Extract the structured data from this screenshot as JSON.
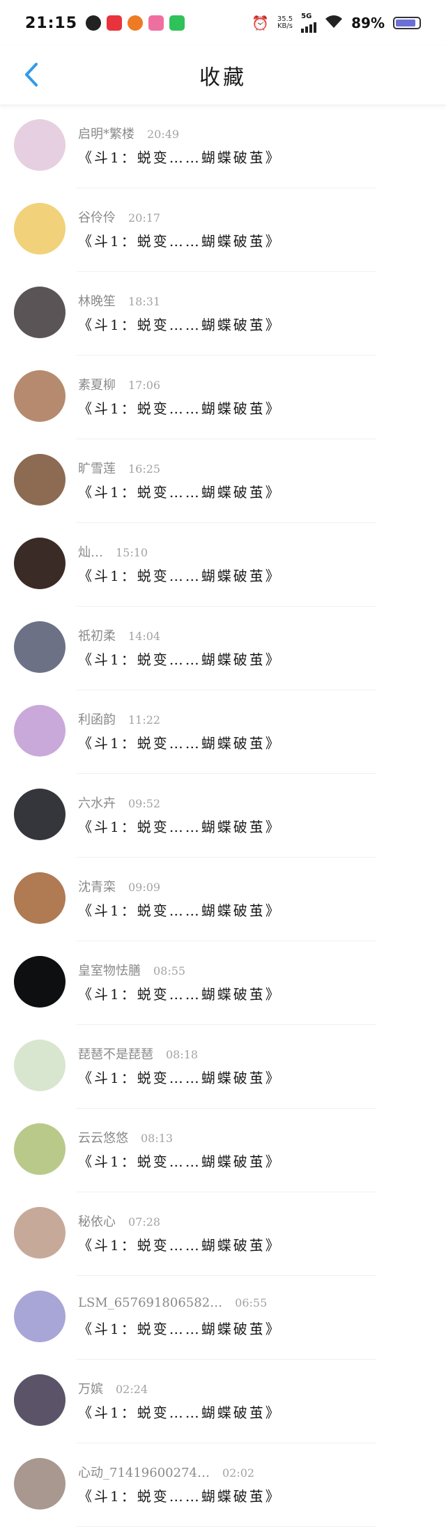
{
  "status_bar": {
    "time": "21:15",
    "network_speed": "35.5",
    "network_unit": "KB/s",
    "network_type": "5G",
    "battery": "89%",
    "battery_level": 0.89
  },
  "header": {
    "title": "收藏",
    "accent_color": "#2f9bea"
  },
  "favorites": [
    {
      "name": "启明*繁楼",
      "time": "20:49",
      "message": "《斗1：蜕变……蝴蝶破茧》",
      "avatar_color": "#e6cfe0"
    },
    {
      "name": "谷伶伶",
      "time": "20:17",
      "message": "《斗1：蜕变……蝴蝶破茧》",
      "avatar_color": "#f1d27a"
    },
    {
      "name": "林晚笙",
      "time": "18:31",
      "message": "《斗1：蜕变……蝴蝶破茧》",
      "avatar_color": "#5a5457"
    },
    {
      "name": "素夏柳",
      "time": "17:06",
      "message": "《斗1：蜕变……蝴蝶破茧》",
      "avatar_color": "#b58a6e"
    },
    {
      "name": "旷雪莲",
      "time": "16:25",
      "message": "《斗1：蜕变……蝴蝶破茧》",
      "avatar_color": "#8d6a52"
    },
    {
      "name": "灿…",
      "time": "15:10",
      "message": "《斗1：蜕变……蝴蝶破茧》",
      "avatar_color": "#3a2b27"
    },
    {
      "name": "祇初柔",
      "time": "14:04",
      "message": "《斗1：蜕变……蝴蝶破茧》",
      "avatar_color": "#6c7186"
    },
    {
      "name": "利函韵",
      "time": "11:22",
      "message": "《斗1：蜕变……蝴蝶破茧》",
      "avatar_color": "#c9a9d9"
    },
    {
      "name": "六水卉",
      "time": "09:52",
      "message": "《斗1：蜕变……蝴蝶破茧》",
      "avatar_color": "#34363c"
    },
    {
      "name": "沈青栾",
      "time": "09:09",
      "message": "《斗1：蜕变……蝴蝶破茧》",
      "avatar_color": "#b07a52"
    },
    {
      "name": "皇室物怯膳",
      "time": "08:55",
      "message": "《斗1：蜕变……蝴蝶破茧》",
      "avatar_color": "#0e0f11"
    },
    {
      "name": "琵琶不是琵琶",
      "time": "08:18",
      "message": "《斗1：蜕变……蝴蝶破茧》",
      "avatar_color": "#d9e6cf"
    },
    {
      "name": "云云悠悠",
      "time": "08:13",
      "message": "《斗1：蜕变……蝴蝶破茧》",
      "avatar_color": "#b9c98a"
    },
    {
      "name": "秘依心",
      "time": "07:28",
      "message": "《斗1：蜕变……蝴蝶破茧》",
      "avatar_color": "#c7a99a"
    },
    {
      "name": "LSM_657691806582…",
      "time": "06:55",
      "message": "《斗1：蜕变……蝴蝶破茧》",
      "avatar_color": "#a8a6d6"
    },
    {
      "name": "万嫔",
      "time": "02:24",
      "message": "《斗1：蜕变……蝴蝶破茧》",
      "avatar_color": "#5b5368"
    },
    {
      "name": "心动_71419600274…",
      "time": "02:02",
      "message": "《斗1：蜕变……蝴蝶破茧》",
      "avatar_color": "#a89890"
    }
  ]
}
